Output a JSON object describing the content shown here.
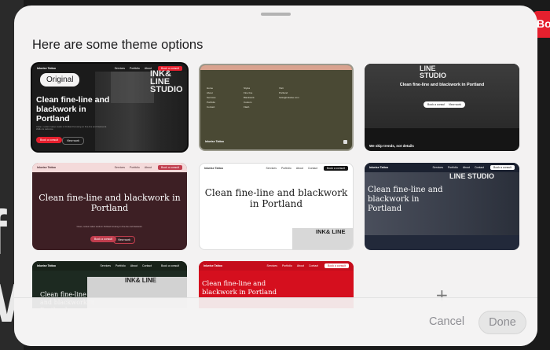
{
  "background": {
    "letter_f": "f",
    "letter_w": "W",
    "right_button_label": "Bo"
  },
  "sheet": {
    "title": "Here are some theme options"
  },
  "themes": [
    {
      "badge": "Original",
      "brand": "Inkwise Tattoo",
      "nav_links": [
        "Services",
        "Portfolio",
        "About"
      ],
      "cta": "Book a consult",
      "headline": "Clean fine-line and blackwork in Portland",
      "sub": "Clean, modern tattoo studio in Portland focusing on fine-line and blackwork. Walk-ins welcome.",
      "primary_btn": "Book a consult",
      "secondary_btn": "View work",
      "sign": "INK& LINE STUDIO"
    },
    {
      "brand": "Inkwise Tattoo",
      "col1": [
        "Home",
        "About",
        "Services",
        "Portfolio",
        "Contact"
      ],
      "col2": [
        "Styles",
        "Fine line",
        "Blackwork",
        "Custom",
        "Flash"
      ],
      "col3": [
        "Visit",
        "Portland",
        "hello@inkwise.com"
      ]
    },
    {
      "sign": "LINE STUDIO",
      "headline": "Clean fine-line and blackwork in Portland",
      "btn1": "Book a consult",
      "btn2": "View work",
      "bottom_text": "We skip trends, not details"
    },
    {
      "brand": "Inkwise Tattoo",
      "nav_links": [
        "Services",
        "Portfolio",
        "About"
      ],
      "cta": "Book a consult",
      "headline": "Clean fine-line and blackwork in Portland",
      "sub": "Clean, modern tattoo studio in Portland focusing on fine-line and blackwork.",
      "btn1": "Book a consult",
      "btn2": "View work"
    },
    {
      "brand": "Inkwise Tattoo",
      "nav_links": [
        "Services",
        "Portfolio",
        "About",
        "Contact"
      ],
      "cta": "Book a consult",
      "headline": "Clean fine-line and blackwork in Portland",
      "sign": "INK& LINE"
    },
    {
      "brand": "Inkwise Tattoo",
      "nav_links": [
        "Services",
        "Portfolio",
        "About",
        "Contact"
      ],
      "cta": "Book a consult",
      "headline": "Clean fine-line and blackwork in Portland",
      "sign": "LINE STUDIO"
    },
    {
      "brand": "Inkwise Tattoo",
      "nav_links": [
        "Services",
        "Portfolio",
        "About",
        "Contact"
      ],
      "cta": "Book a consult",
      "headline": "Clean fine-line and blackwork in Portland",
      "sign": "INK& LINE"
    },
    {
      "brand": "Inkwise Tattoo",
      "nav_links": [
        "Services",
        "Portfolio",
        "About",
        "Contact"
      ],
      "cta": "Book a consult",
      "headline": "Clean fine-line and blackwork in Portland"
    }
  ],
  "add_icon": "+",
  "footer": {
    "cancel_label": "Cancel",
    "done_label": "Done"
  },
  "colors": {
    "sheet_bg": "#f3f2f2",
    "accent_red": "#e5202e",
    "olive": "#4a4934",
    "maroon": "#3d1f24",
    "navy": "#22293a",
    "forest": "#1d2a21",
    "red_theme": "#d50f1e"
  }
}
